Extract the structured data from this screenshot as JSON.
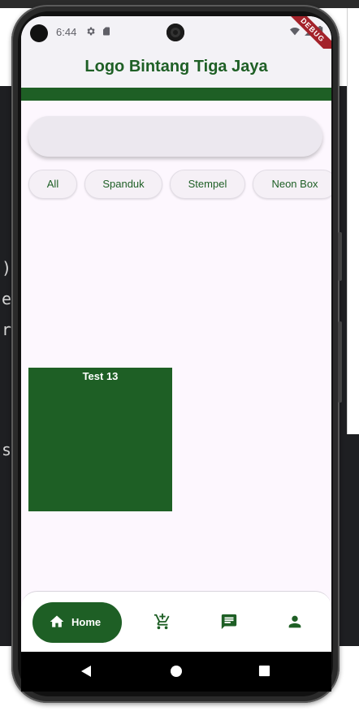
{
  "host": {
    "code_fragments": [
      ")",
      "e",
      "r",
      "s"
    ]
  },
  "status_bar": {
    "time": "6:44",
    "debug_banner": "DEBUG"
  },
  "app_bar": {
    "title": "Logo Bintang Tiga Jaya"
  },
  "search": {
    "value": "",
    "placeholder": ""
  },
  "categories": [
    {
      "label": "All"
    },
    {
      "label": "Spanduk"
    },
    {
      "label": "Stempel"
    },
    {
      "label": "Neon Box"
    }
  ],
  "products": [
    {
      "title": "Test 13"
    }
  ],
  "bottom_nav": {
    "items": [
      {
        "label": "Home",
        "icon": "home-icon",
        "active": true
      },
      {
        "label": "",
        "icon": "cart-icon",
        "active": false
      },
      {
        "label": "",
        "icon": "chat-icon",
        "active": false
      },
      {
        "label": "",
        "icon": "person-icon",
        "active": false
      }
    ]
  },
  "colors": {
    "primary_green": "#1e5f25",
    "surface": "#fdf7fe",
    "app_bar_bg": "#f3f2f6",
    "chip_bg": "#f5f0f6",
    "debug_red": "#a3222a"
  }
}
